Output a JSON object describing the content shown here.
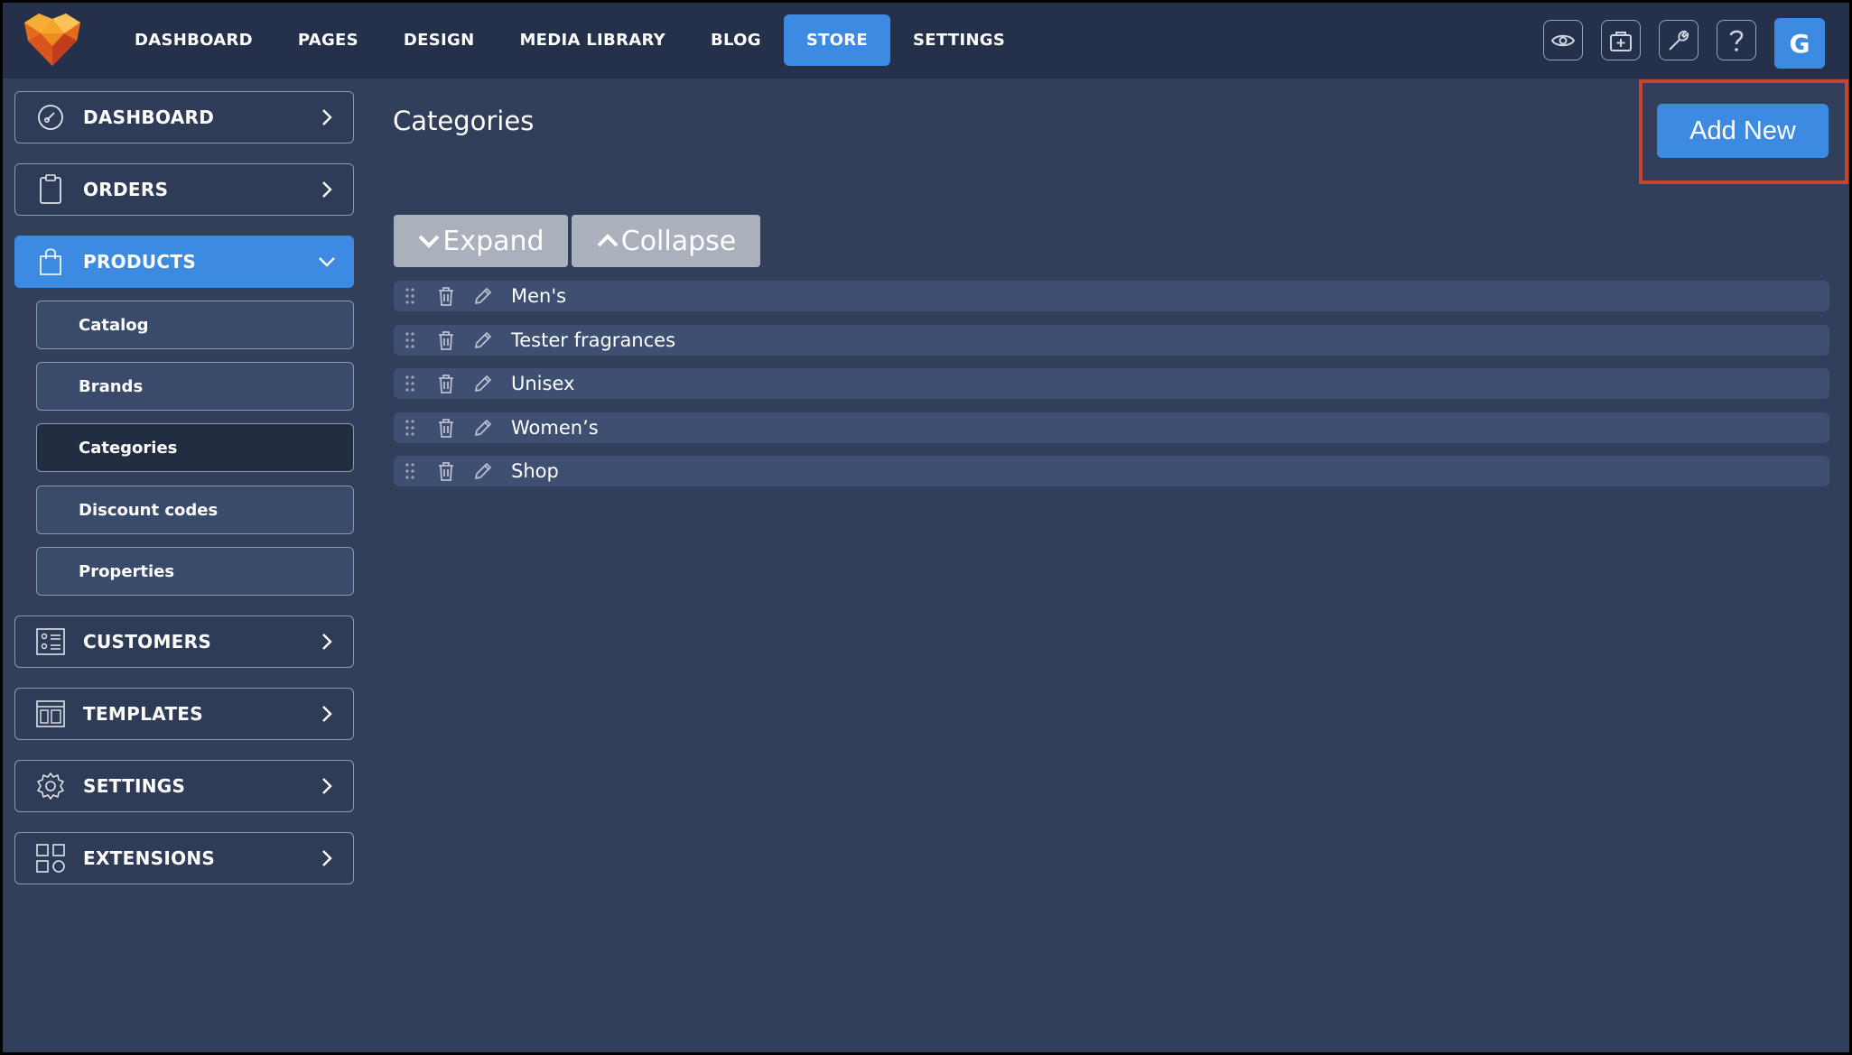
{
  "nav": {
    "items": [
      "DASHBOARD",
      "PAGES",
      "DESIGN",
      "MEDIA LIBRARY",
      "BLOG",
      "STORE",
      "SETTINGS"
    ],
    "active": "STORE"
  },
  "toolbar": {
    "icons": [
      "eye-icon",
      "briefcase-add-icon",
      "wrench-icon",
      "question-icon"
    ],
    "avatar_letter": "G"
  },
  "sidebar": {
    "dashboard": "DASHBOARD",
    "orders": "ORDERS",
    "products": "PRODUCTS",
    "sub": [
      "Catalog",
      "Brands",
      "Categories",
      "Discount codes",
      "Properties"
    ],
    "active_sub": "Categories",
    "customers": "CUSTOMERS",
    "templates": "TEMPLATES",
    "settings": "SETTINGS",
    "extensions": "EXTENSIONS"
  },
  "main": {
    "title": "Categories",
    "add_new": "Add New",
    "expand": "Expand",
    "collapse": "Collapse",
    "categories": [
      "Men's",
      "Tester fragrances",
      "Unisex",
      "Women’s",
      "Shop"
    ]
  },
  "colors": {
    "accent": "#3d8ae3",
    "highlight": "#c9432e",
    "background": "#313f5a",
    "topbar": "#25304a"
  }
}
